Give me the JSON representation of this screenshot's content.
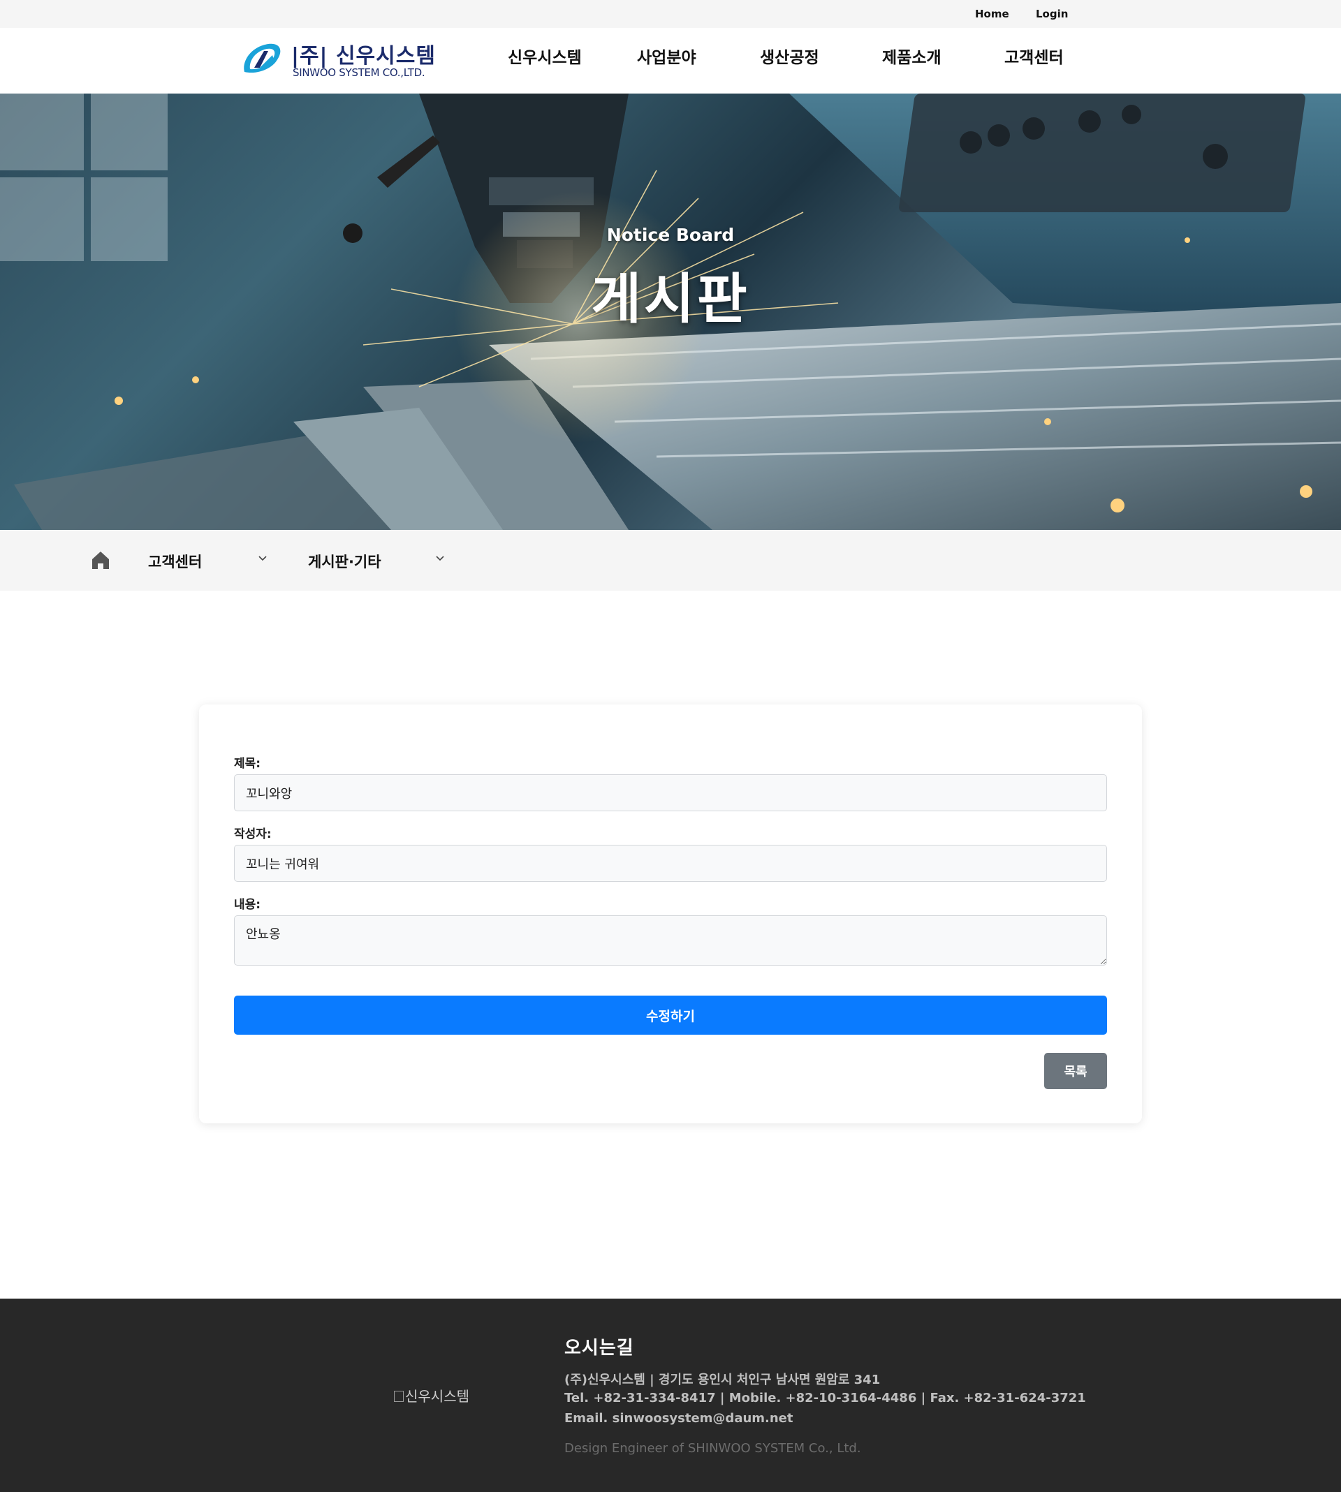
{
  "topbar": {
    "home": "Home",
    "login": "Login"
  },
  "brand": {
    "name_kr": "|주| 신우시스템",
    "name_en": "SINWOO SYSTEM CO.,LTD.",
    "color": "#1b2b6b",
    "accent": "#1aa3d9"
  },
  "nav": [
    "신우시스템",
    "사업분야",
    "생산공정",
    "제품소개",
    "고객센터"
  ],
  "hero": {
    "subtitle": "Notice Board",
    "title": "게시판"
  },
  "breadcrumb": {
    "home_icon": "home-icon",
    "level1": "고객센터",
    "level2": "게시판·기타"
  },
  "form": {
    "title_label": "제목:",
    "title_value": "꼬니와앙",
    "author_label": "작성자:",
    "author_value": "꼬니는 귀여워",
    "content_label": "내용:",
    "content_value": "안뇨옹",
    "submit_label": "수정하기",
    "list_label": "목록",
    "primary_color": "#0a7bff",
    "secondary_color": "#6c757d"
  },
  "footer": {
    "logo_alt": "신우시스템",
    "heading": "오시는길",
    "address": "(주)신우시스템   |   경기도 용인시 처인구 남사면 원암로 341",
    "contact": "Tel. +82-31-334-8417   |   Mobile. +82-10-3164-4486   |   Fax. +82-31-624-3721",
    "email": "Email. sinwoosystem@daum.net",
    "copyright": "Design Engineer of SHINWOO SYSTEM Co., Ltd."
  }
}
